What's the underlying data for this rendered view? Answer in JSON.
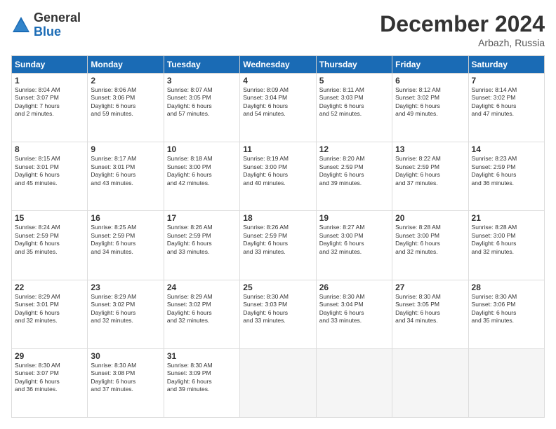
{
  "header": {
    "logo_general": "General",
    "logo_blue": "Blue",
    "month_title": "December 2024",
    "location": "Arbazh, Russia"
  },
  "days_of_week": [
    "Sunday",
    "Monday",
    "Tuesday",
    "Wednesday",
    "Thursday",
    "Friday",
    "Saturday"
  ],
  "weeks": [
    [
      {
        "day": "1",
        "sunrise": "8:04 AM",
        "sunset": "3:07 PM",
        "daylight": "7 hours and 2 minutes."
      },
      {
        "day": "2",
        "sunrise": "8:06 AM",
        "sunset": "3:06 PM",
        "daylight": "6 hours and 59 minutes."
      },
      {
        "day": "3",
        "sunrise": "8:07 AM",
        "sunset": "3:05 PM",
        "daylight": "6 hours and 57 minutes."
      },
      {
        "day": "4",
        "sunrise": "8:09 AM",
        "sunset": "3:04 PM",
        "daylight": "6 hours and 54 minutes."
      },
      {
        "day": "5",
        "sunrise": "8:11 AM",
        "sunset": "3:03 PM",
        "daylight": "6 hours and 52 minutes."
      },
      {
        "day": "6",
        "sunrise": "8:12 AM",
        "sunset": "3:02 PM",
        "daylight": "6 hours and 49 minutes."
      },
      {
        "day": "7",
        "sunrise": "8:14 AM",
        "sunset": "3:02 PM",
        "daylight": "6 hours and 47 minutes."
      }
    ],
    [
      {
        "day": "8",
        "sunrise": "8:15 AM",
        "sunset": "3:01 PM",
        "daylight": "6 hours and 45 minutes."
      },
      {
        "day": "9",
        "sunrise": "8:17 AM",
        "sunset": "3:01 PM",
        "daylight": "6 hours and 43 minutes."
      },
      {
        "day": "10",
        "sunrise": "8:18 AM",
        "sunset": "3:00 PM",
        "daylight": "6 hours and 42 minutes."
      },
      {
        "day": "11",
        "sunrise": "8:19 AM",
        "sunset": "3:00 PM",
        "daylight": "6 hours and 40 minutes."
      },
      {
        "day": "12",
        "sunrise": "8:20 AM",
        "sunset": "2:59 PM",
        "daylight": "6 hours and 39 minutes."
      },
      {
        "day": "13",
        "sunrise": "8:22 AM",
        "sunset": "2:59 PM",
        "daylight": "6 hours and 37 minutes."
      },
      {
        "day": "14",
        "sunrise": "8:23 AM",
        "sunset": "2:59 PM",
        "daylight": "6 hours and 36 minutes."
      }
    ],
    [
      {
        "day": "15",
        "sunrise": "8:24 AM",
        "sunset": "2:59 PM",
        "daylight": "6 hours and 35 minutes."
      },
      {
        "day": "16",
        "sunrise": "8:25 AM",
        "sunset": "2:59 PM",
        "daylight": "6 hours and 34 minutes."
      },
      {
        "day": "17",
        "sunrise": "8:26 AM",
        "sunset": "2:59 PM",
        "daylight": "6 hours and 33 minutes."
      },
      {
        "day": "18",
        "sunrise": "8:26 AM",
        "sunset": "2:59 PM",
        "daylight": "6 hours and 33 minutes."
      },
      {
        "day": "19",
        "sunrise": "8:27 AM",
        "sunset": "3:00 PM",
        "daylight": "6 hours and 32 minutes."
      },
      {
        "day": "20",
        "sunrise": "8:28 AM",
        "sunset": "3:00 PM",
        "daylight": "6 hours and 32 minutes."
      },
      {
        "day": "21",
        "sunrise": "8:28 AM",
        "sunset": "3:00 PM",
        "daylight": "6 hours and 32 minutes."
      }
    ],
    [
      {
        "day": "22",
        "sunrise": "8:29 AM",
        "sunset": "3:01 PM",
        "daylight": "6 hours and 32 minutes."
      },
      {
        "day": "23",
        "sunrise": "8:29 AM",
        "sunset": "3:02 PM",
        "daylight": "6 hours and 32 minutes."
      },
      {
        "day": "24",
        "sunrise": "8:29 AM",
        "sunset": "3:02 PM",
        "daylight": "6 hours and 32 minutes."
      },
      {
        "day": "25",
        "sunrise": "8:30 AM",
        "sunset": "3:03 PM",
        "daylight": "6 hours and 33 minutes."
      },
      {
        "day": "26",
        "sunrise": "8:30 AM",
        "sunset": "3:04 PM",
        "daylight": "6 hours and 33 minutes."
      },
      {
        "day": "27",
        "sunrise": "8:30 AM",
        "sunset": "3:05 PM",
        "daylight": "6 hours and 34 minutes."
      },
      {
        "day": "28",
        "sunrise": "8:30 AM",
        "sunset": "3:06 PM",
        "daylight": "6 hours and 35 minutes."
      }
    ],
    [
      {
        "day": "29",
        "sunrise": "8:30 AM",
        "sunset": "3:07 PM",
        "daylight": "6 hours and 36 minutes."
      },
      {
        "day": "30",
        "sunrise": "8:30 AM",
        "sunset": "3:08 PM",
        "daylight": "6 hours and 37 minutes."
      },
      {
        "day": "31",
        "sunrise": "8:30 AM",
        "sunset": "3:09 PM",
        "daylight": "6 hours and 39 minutes."
      },
      null,
      null,
      null,
      null
    ]
  ]
}
